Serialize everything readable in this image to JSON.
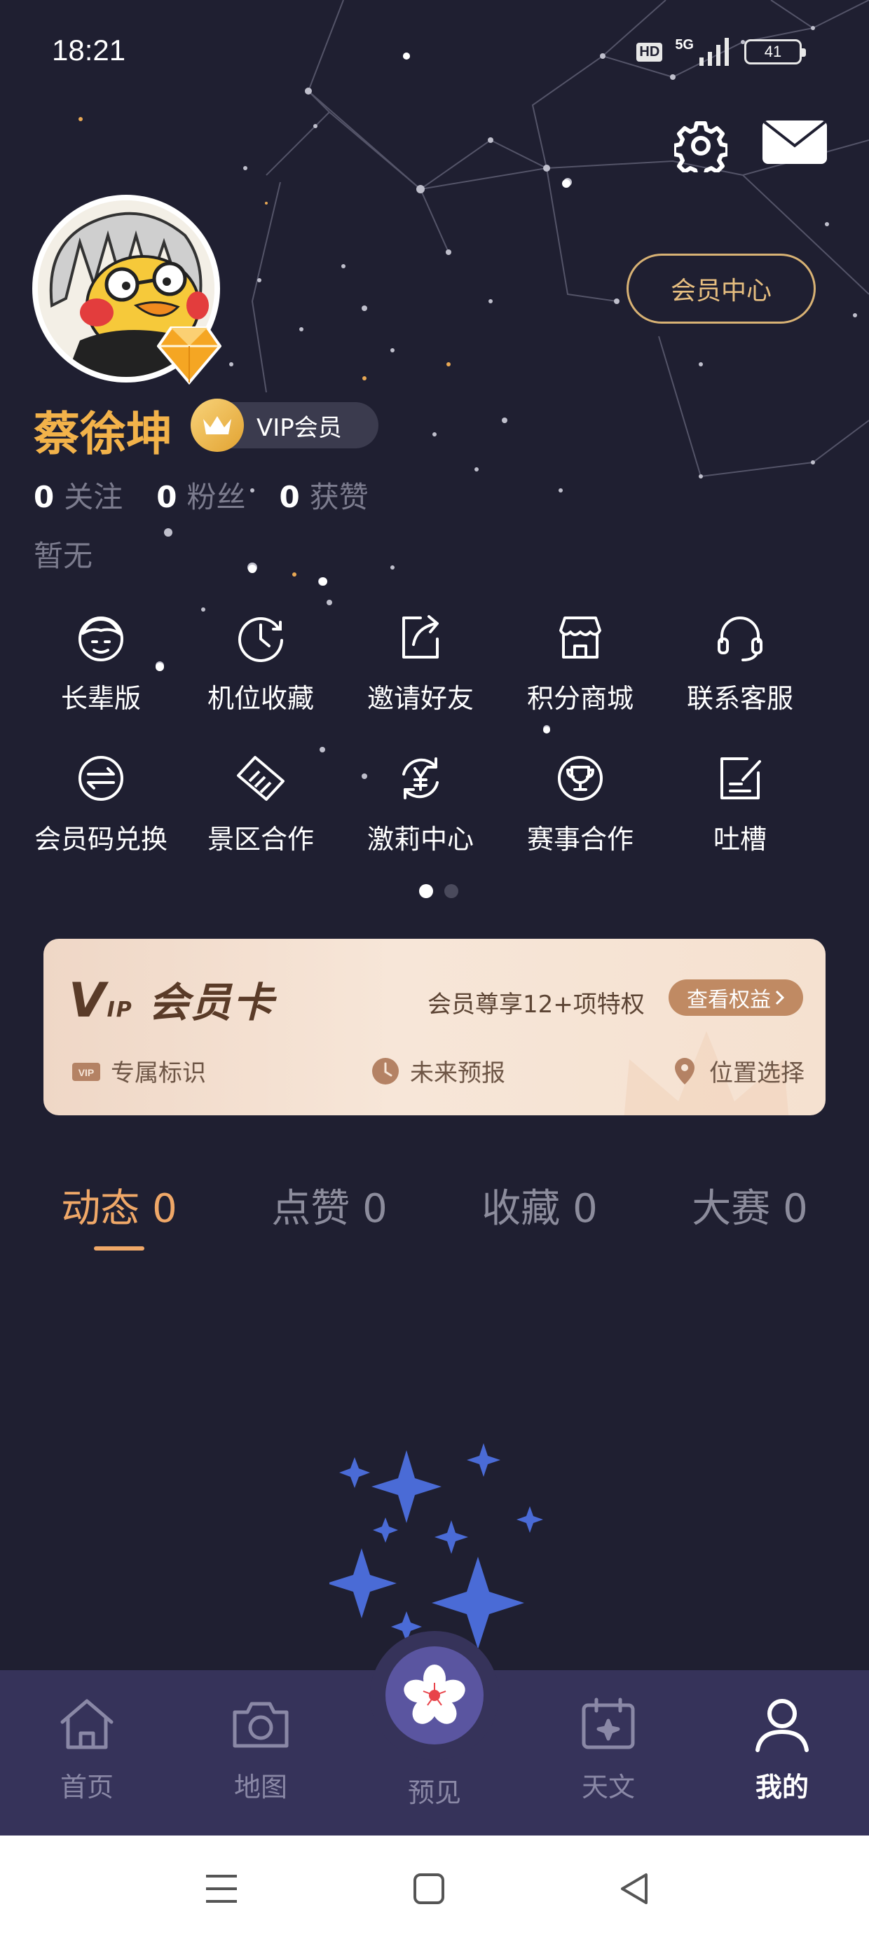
{
  "status_bar": {
    "time": "18:21",
    "hd_badge": "HD",
    "network": "5G",
    "battery": "41"
  },
  "header": {
    "settings_icon": "gear-icon",
    "mail_icon": "mail-icon",
    "member_center_label": "会员中心"
  },
  "profile": {
    "username": "蔡徐坤",
    "vip_badge_label": "VIP会员",
    "stats": [
      {
        "value": "0",
        "label": "关注"
      },
      {
        "value": "0",
        "label": "粉丝"
      },
      {
        "value": "0",
        "label": "获赞"
      }
    ],
    "bio": "暂无"
  },
  "quick_actions": [
    {
      "label": "长辈版",
      "icon": "elder-face-icon"
    },
    {
      "label": "机位收藏",
      "icon": "clock-icon"
    },
    {
      "label": "邀请好友",
      "icon": "share-icon"
    },
    {
      "label": "积分商城",
      "icon": "store-icon"
    },
    {
      "label": "联系客服",
      "icon": "headset-icon"
    },
    {
      "label": "会员码兑换",
      "icon": "exchange-icon"
    },
    {
      "label": "景区合作",
      "icon": "handshake-icon"
    },
    {
      "label": "激莉中心",
      "icon": "yuan-cycle-icon"
    },
    {
      "label": "赛事合作",
      "icon": "trophy-icon"
    },
    {
      "label": "吐槽",
      "icon": "edit-note-icon"
    }
  ],
  "pager": {
    "pages": 2,
    "active": 1
  },
  "vip_card": {
    "title_v": "V",
    "title_ip": "IP",
    "title_text": "会员卡",
    "promo": "会员尊享12+项特权",
    "button_label": "查看权益",
    "features": [
      {
        "label": "专属标识",
        "icon": "vip-tag-icon"
      },
      {
        "label": "未来预报",
        "icon": "clock-icon"
      },
      {
        "label": "位置选择",
        "icon": "location-pin-icon"
      }
    ]
  },
  "tabs": [
    {
      "label": "动态 0",
      "active": true
    },
    {
      "label": "点赞 0",
      "active": false
    },
    {
      "label": "收藏 0",
      "active": false
    },
    {
      "label": "大赛 0",
      "active": false
    }
  ],
  "bottom_nav": {
    "items": [
      {
        "label": "首页",
        "icon": "home-icon"
      },
      {
        "label": "地图",
        "icon": "camera-icon"
      },
      {
        "label": "预见",
        "icon": "flower-icon"
      },
      {
        "label": "天文",
        "icon": "calendar-icon"
      },
      {
        "label": "我的",
        "icon": "user-icon"
      }
    ],
    "active": "我的"
  },
  "colors": {
    "background": "#1f1f31",
    "accent_gold": "#f2b24a",
    "tab_active": "#f0a868",
    "nav_bar": "#36335a"
  }
}
